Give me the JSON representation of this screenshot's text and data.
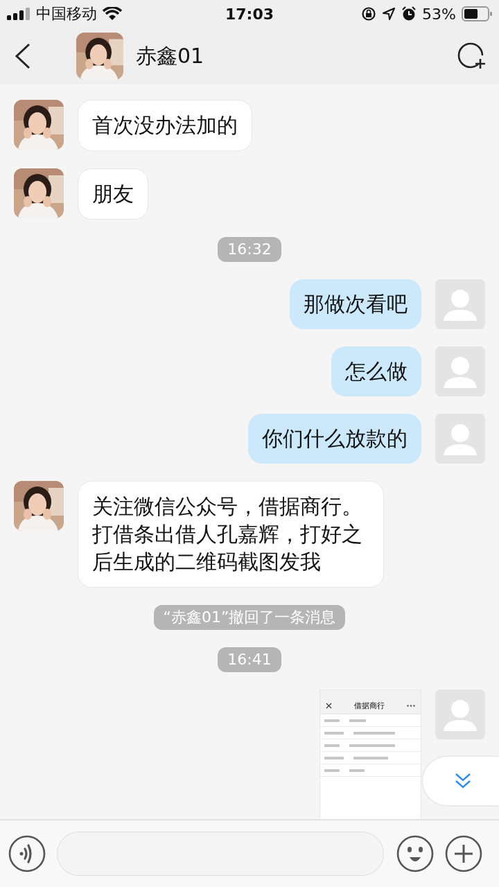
{
  "status_bar": {
    "carrier": "中国移动",
    "time": "17:03",
    "battery": "53%"
  },
  "header": {
    "title": "赤鑫01"
  },
  "messages": [
    {
      "kind": "incoming",
      "text": "首次没办法加的"
    },
    {
      "kind": "incoming",
      "text": "朋友"
    },
    {
      "kind": "time",
      "text": "16:32"
    },
    {
      "kind": "outgoing",
      "text": "那做次看吧"
    },
    {
      "kind": "outgoing",
      "text": "怎么做"
    },
    {
      "kind": "outgoing",
      "text": "你们什么放款的"
    },
    {
      "kind": "incoming",
      "text": "关注微信公众号，借据商行。打借条出借人孔嘉辉，打好之后生成的二维码截图发我"
    },
    {
      "kind": "notice",
      "text": "“赤鑫01”撤回了一条消息"
    },
    {
      "kind": "time",
      "text": "16:41"
    },
    {
      "kind": "outgoing_image",
      "title": "借据商行"
    }
  ]
}
